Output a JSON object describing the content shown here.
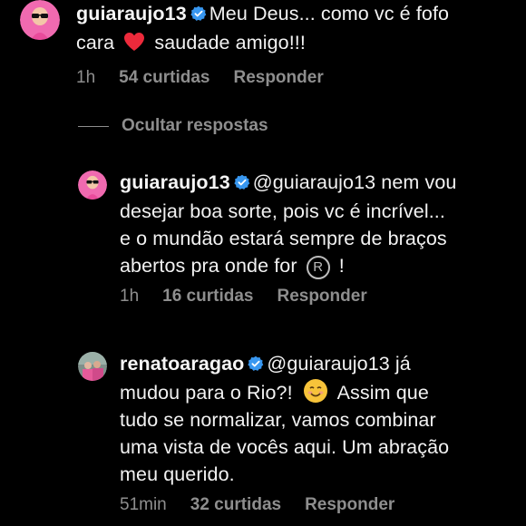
{
  "comments": [
    {
      "username": "guiaraujo13",
      "text_line1": "Meu Deus... como vc é fofo",
      "text_line2_a": "cara",
      "text_line2_b": "saudade amigo!!!",
      "time": "1h",
      "likes": "54 curtidas",
      "reply": "Responder"
    }
  ],
  "hide_replies": "Ocultar respostas",
  "replies": [
    {
      "username": "guiaraujo13",
      "mention": "@guiaraujo13",
      "text_a": "nem vou",
      "line2": "desejar boa sorte, pois vc é incrível...",
      "line3": "e o mundão estará sempre de braços",
      "line4_a": "abertos pra onde for",
      "line4_b": "!",
      "reg_symbol": "R",
      "time": "1h",
      "likes": "16 curtidas",
      "reply": "Responder"
    },
    {
      "username": "renatoaragao",
      "mention": "@guiaraujo13",
      "text_a": "já",
      "line2_a": "mudou para o Rio?!",
      "line2_b": "Assim que",
      "line3": "tudo se normalizar, vamos combinar",
      "line4": "uma vista de vocês aqui. Um abração",
      "line5": "meu querido.",
      "time": "51min",
      "likes": "32 curtidas",
      "reply": "Responder"
    }
  ],
  "colors": {
    "background": "#000000",
    "text": "#f2f2f2",
    "muted": "#8e8e8e",
    "verified": "#3897f0",
    "heart": "#ed2a3b",
    "avatar_pink": "#f06ab0"
  }
}
